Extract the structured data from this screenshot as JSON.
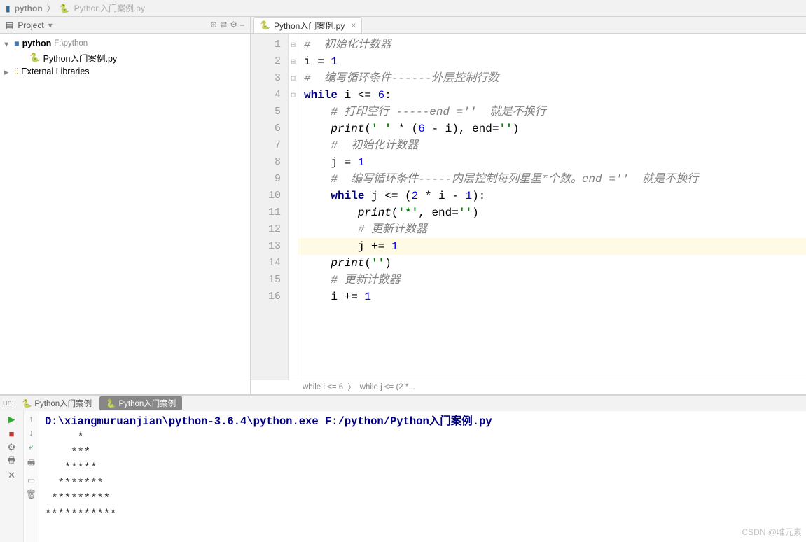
{
  "breadcrumb": {
    "root": "python",
    "sep": "〉",
    "file": "Python入门案例.py"
  },
  "sidebar": {
    "title": "Project",
    "project_name": "python",
    "project_path": "F:\\python",
    "file": "Python入门案例.py",
    "libs": "External Libraries"
  },
  "editor": {
    "tab": "Python入门案例.py",
    "lines": [
      {
        "n": 1,
        "html": "<span class='c-cmt'>#  初始化计数器</span>"
      },
      {
        "n": 2,
        "html": "i = <span class='c-num'>1</span>"
      },
      {
        "n": 3,
        "html": "<span class='c-cmt'>#  编写循环条件------外层控制行数</span>"
      },
      {
        "n": 4,
        "html": "<span class='c-kw'>while</span> i &lt;= <span class='c-num'>6</span>:"
      },
      {
        "n": 5,
        "html": "    <span class='c-cmt'># 打印空行 -----end =''  就是不换行</span>"
      },
      {
        "n": 6,
        "html": "    <span class='c-fn'>print</span>(<span class='c-str'>' '</span> * (<span class='c-num'>6</span> - i), end=<span class='c-str'>''</span>)"
      },
      {
        "n": 7,
        "html": "    <span class='c-cmt'>#  初始化计数器</span>"
      },
      {
        "n": 8,
        "html": "    j = <span class='c-num'>1</span>"
      },
      {
        "n": 9,
        "html": "    <span class='c-cmt'>#  编写循环条件-----内层控制每列星星*个数。end =''  就是不换行</span>"
      },
      {
        "n": 10,
        "html": "    <span class='c-kw'>while</span> j &lt;= (<span class='c-num'>2</span> * i - <span class='c-num'>1</span>):"
      },
      {
        "n": 11,
        "html": "        <span class='c-fn'>print</span>(<span class='c-str'>'*'</span>, end=<span class='c-str'>''</span>)"
      },
      {
        "n": 12,
        "html": "        <span class='c-cmt'># 更新计数器</span>"
      },
      {
        "n": 13,
        "html": "        j += <span class='c-num'>1</span>",
        "hl": true
      },
      {
        "n": 14,
        "html": "    <span class='c-fn'>print</span>(<span class='c-str'>''</span>)"
      },
      {
        "n": 15,
        "html": "    <span class='c-cmt'># 更新计数器</span>"
      },
      {
        "n": 16,
        "html": "    i += <span class='c-num'>1</span>"
      }
    ],
    "fold": {
      "4": "⊟",
      "10": "⊟",
      "13": "⊟",
      "16": "⊟"
    },
    "crumbs": [
      "while i <= 6",
      "while j <= (2 *..."
    ]
  },
  "run": {
    "label": "un:",
    "tabs": [
      "Python入门案例",
      "Python入门案例"
    ],
    "cmd": "D:\\xiangmuruanjian\\python-3.6.4\\python.exe F:/python/Python入门案例.py",
    "output": [
      "     *",
      "    ***",
      "   *****",
      "  *******",
      " *********",
      "***********"
    ]
  },
  "watermark": "CSDN @唯元素"
}
